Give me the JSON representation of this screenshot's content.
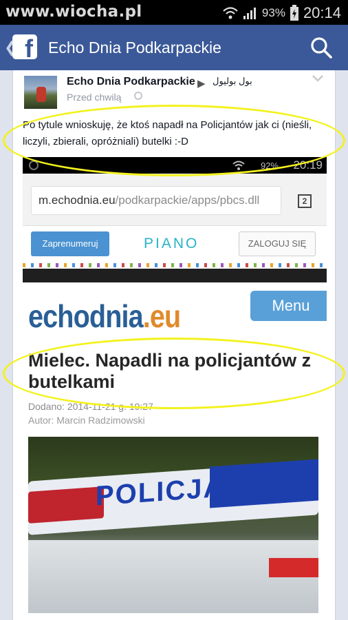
{
  "statusbar": {
    "watermark": "www.wiocha.pl",
    "battery": "93%",
    "time": "20:14"
  },
  "header": {
    "title": "Echo Dnia Podkarpackie",
    "back_glyph": "❮",
    "logo_glyph": "f"
  },
  "post": {
    "page_name": "Echo Dnia Podkarpackie",
    "arrow_glyph": "▶",
    "target_name": "بول بوليول",
    "time": "Przed chwilą",
    "text": "Po tytule wnioskuję, że ktoś napadł na Policjantów jak ci (nieśli, liczyli, zbierali, opróżniali) butelki :-D"
  },
  "screenshot": {
    "battery": "92%",
    "time": "20:19",
    "url_domain": "m.echodnia.eu",
    "url_path": "/podkarpackie/apps/pbcs.dll",
    "tab_count": "2",
    "subscribe_label": "Zaprenumeruj",
    "piano_logo": "PIANO",
    "login_label": "ZALOGUJ SIĘ",
    "site_logo_main": "echodnia",
    "site_logo_tld": ".eu",
    "menu_label": "Menu",
    "headline": "Mielec. Napadli na policjantów z butelkami",
    "date": "Dodano: 2014-11-21 g. 19:27",
    "author": "Autor: Marcin Radzimowski",
    "photo_text": "POLICJA"
  },
  "colors": {
    "facebook_blue": "#3b5998",
    "highlight_yellow": "#f3f21e",
    "site_blue": "#2a5f96"
  }
}
